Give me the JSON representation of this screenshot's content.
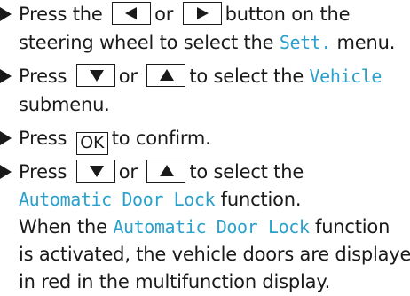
{
  "colors": {
    "text": "#1a1a1a",
    "highlight": "#2aa0cc"
  },
  "keys": {
    "left": "left-arrow-icon",
    "right": "right-arrow-icon",
    "down": "down-arrow-icon",
    "up": "up-arrow-icon",
    "ok": "OK"
  },
  "step1": {
    "l1_a": "Press the",
    "l1_or": "or",
    "l1_b": "button on the",
    "l2_a": "steering wheel to select the",
    "l2_hl": "Sett.",
    "l2_b": "menu."
  },
  "step2": {
    "l1_a": "Press",
    "l1_or": "or",
    "l1_b": "to select the",
    "l1_hl": "Vehicle",
    "l2": "submenu."
  },
  "step3": {
    "l1_a": "Press",
    "l1_b": "to confirm."
  },
  "step4": {
    "l1_a": "Press",
    "l1_or": "or",
    "l1_b": "to select the",
    "l2_hl": "Automatic Door Lock",
    "l2_b": "function.",
    "l3_a": "When the",
    "l3_hl": "Automatic Door Lock",
    "l3_b": "function",
    "l4": "is activated, the vehicle doors are displayed",
    "l5": "in red in the multifunction display."
  }
}
